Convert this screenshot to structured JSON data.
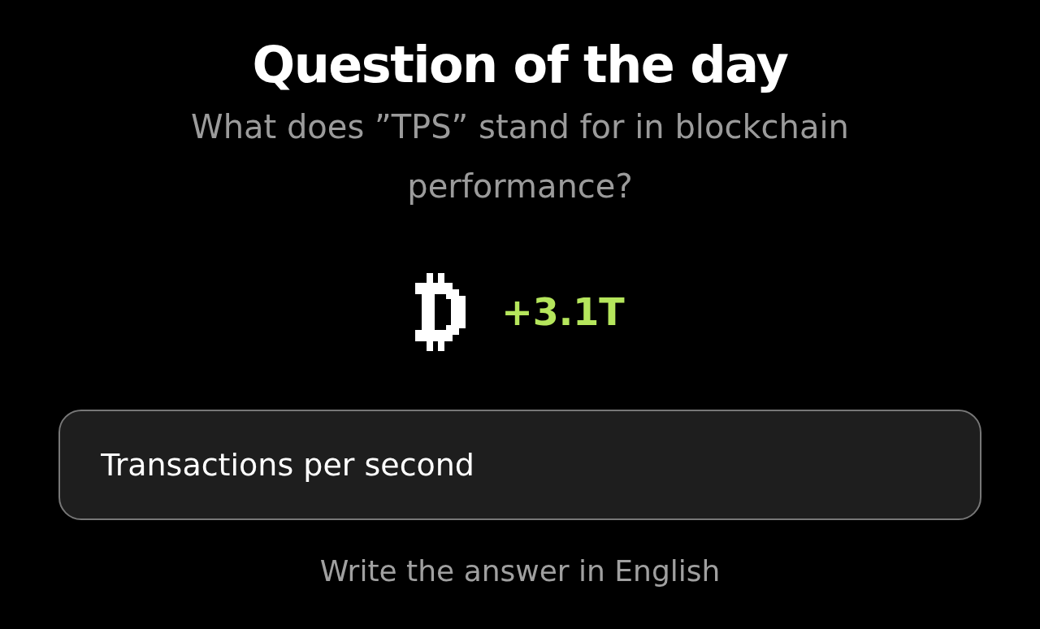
{
  "title": "Question of the day",
  "question": "What does ”TPS” stand for in blockchain performance?",
  "reward": {
    "amount": "+3.1T"
  },
  "answer": {
    "value": "Transactions per second"
  },
  "hint": "Write the answer in English"
}
